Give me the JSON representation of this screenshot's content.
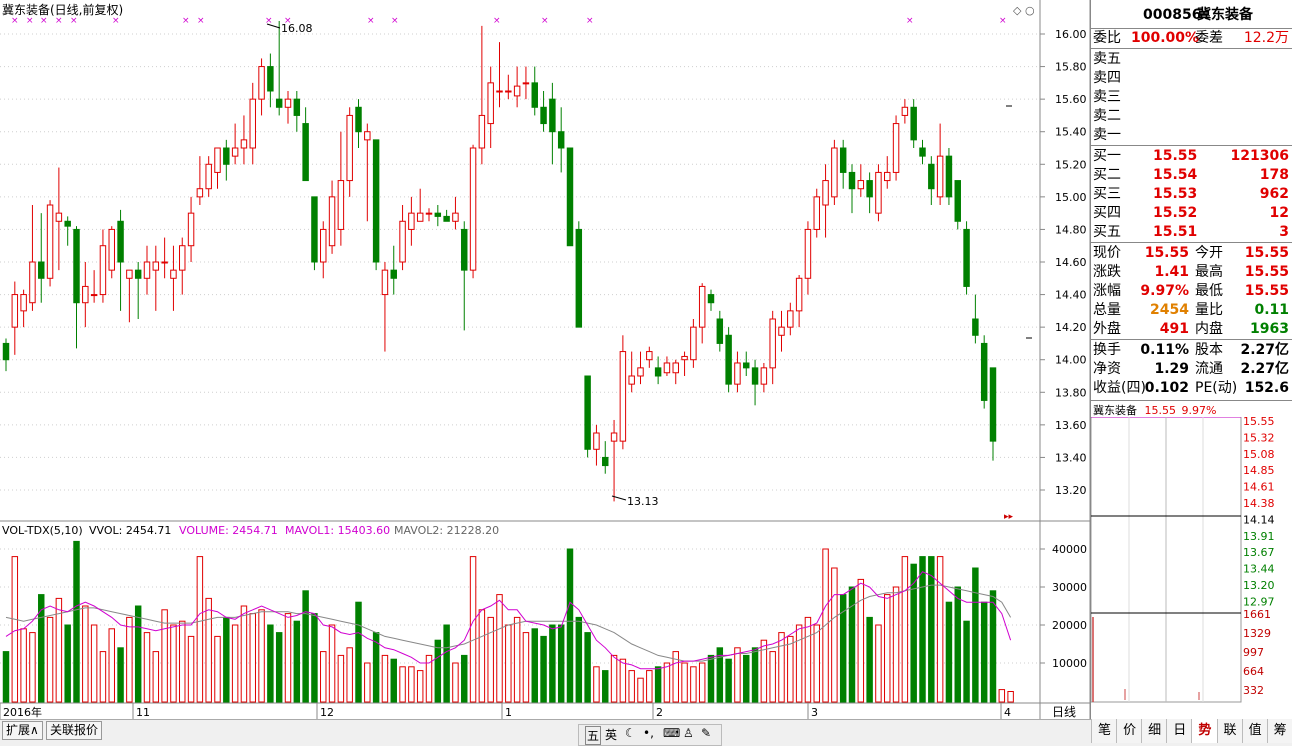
{
  "chart": {
    "title": "冀东装备(日线,前复权)",
    "max_label": "16.08",
    "min_label": "13.13",
    "price_ticks": [
      "16.00",
      "15.80",
      "15.60",
      "15.40",
      "15.20",
      "15.00",
      "14.80",
      "14.60",
      "14.40",
      "14.20",
      "14.00",
      "13.80",
      "13.60",
      "13.40",
      "13.20"
    ],
    "vol_ticks": [
      "40000",
      "30000",
      "20000",
      "10000"
    ],
    "date_labels": [
      "2016年",
      "11",
      "12",
      "1",
      "2",
      "3",
      "4"
    ],
    "period_label": "日线",
    "volume_header": {
      "name": "VOL-TDX(5,10)",
      "vvol": "VVOL: 2454.71",
      "volume": "VOLUME: 2454.71",
      "mavol1": "MAVOL1: 15403.60",
      "mavol2": "MAVOL2: 21228.20"
    },
    "colors": {
      "up": "#e00000",
      "down": "#008000",
      "ma1": "#d000d0",
      "ma2": "#888888"
    }
  },
  "chart_data": {
    "type": "candlestick",
    "title": "冀东装备(日线,前复权)",
    "ylim": [
      13.0,
      16.15
    ],
    "candles": [
      {
        "o": 14.1,
        "c": 14.0,
        "h": 14.13,
        "l": 13.93
      },
      {
        "o": 14.2,
        "c": 14.4,
        "h": 14.48,
        "l": 14.03
      },
      {
        "o": 14.3,
        "c": 14.4,
        "h": 14.43,
        "l": 14.2
      },
      {
        "o": 14.35,
        "c": 14.6,
        "h": 14.95,
        "l": 14.3
      },
      {
        "o": 14.6,
        "c": 14.5,
        "h": 14.9,
        "l": 14.35
      },
      {
        "o": 14.5,
        "c": 14.95,
        "h": 14.98,
        "l": 14.45
      },
      {
        "o": 14.85,
        "c": 14.9,
        "h": 15.18,
        "l": 14.55
      },
      {
        "o": 14.85,
        "c": 14.82,
        "h": 14.88,
        "l": 14.7
      },
      {
        "o": 14.8,
        "c": 14.35,
        "h": 14.82,
        "l": 14.07
      },
      {
        "o": 14.35,
        "c": 14.45,
        "h": 14.6,
        "l": 14.2
      },
      {
        "o": 14.4,
        "c": 14.4,
        "h": 14.55,
        "l": 14.35
      },
      {
        "o": 14.4,
        "c": 14.7,
        "h": 14.8,
        "l": 14.35
      },
      {
        "o": 14.55,
        "c": 14.8,
        "h": 14.82,
        "l": 14.5
      },
      {
        "o": 14.85,
        "c": 14.6,
        "h": 14.92,
        "l": 14.3
      },
      {
        "o": 14.5,
        "c": 14.55,
        "h": 14.55,
        "l": 14.23
      },
      {
        "o": 14.55,
        "c": 14.5,
        "h": 14.6,
        "l": 14.25
      },
      {
        "o": 14.5,
        "c": 14.6,
        "h": 14.7,
        "l": 14.4
      },
      {
        "o": 14.55,
        "c": 14.6,
        "h": 14.7,
        "l": 14.3
      },
      {
        "o": 14.6,
        "c": 14.6,
        "h": 14.75,
        "l": 14.5
      },
      {
        "o": 14.5,
        "c": 14.55,
        "h": 14.7,
        "l": 14.3
      },
      {
        "o": 14.55,
        "c": 14.7,
        "h": 14.75,
        "l": 14.4
      },
      {
        "o": 14.7,
        "c": 14.9,
        "h": 15.0,
        "l": 14.6
      },
      {
        "o": 15.0,
        "c": 15.05,
        "h": 15.25,
        "l": 14.95
      },
      {
        "o": 15.05,
        "c": 15.2,
        "h": 15.25,
        "l": 15.0
      },
      {
        "o": 15.15,
        "c": 15.3,
        "h": 15.3,
        "l": 15.05
      },
      {
        "o": 15.3,
        "c": 15.2,
        "h": 15.35,
        "l": 15.1
      },
      {
        "o": 15.25,
        "c": 15.3,
        "h": 15.45,
        "l": 15.2
      },
      {
        "o": 15.3,
        "c": 15.35,
        "h": 15.5,
        "l": 15.2
      },
      {
        "o": 15.3,
        "c": 15.6,
        "h": 15.7,
        "l": 15.2
      },
      {
        "o": 15.6,
        "c": 15.8,
        "h": 15.85,
        "l": 15.5
      },
      {
        "o": 15.8,
        "c": 15.65,
        "h": 15.88,
        "l": 15.55
      },
      {
        "o": 15.6,
        "c": 15.55,
        "h": 16.08,
        "l": 15.5
      },
      {
        "o": 15.55,
        "c": 15.6,
        "h": 15.65,
        "l": 15.45
      },
      {
        "o": 15.6,
        "c": 15.5,
        "h": 15.65,
        "l": 15.4
      },
      {
        "o": 15.45,
        "c": 15.1,
        "h": 15.55,
        "l": 15.1
      },
      {
        "o": 15.0,
        "c": 14.6,
        "h": 15.0,
        "l": 14.55
      },
      {
        "o": 14.6,
        "c": 14.8,
        "h": 14.85,
        "l": 14.5
      },
      {
        "o": 14.7,
        "c": 15.0,
        "h": 15.1,
        "l": 14.65
      },
      {
        "o": 14.8,
        "c": 15.1,
        "h": 15.4,
        "l": 14.7
      },
      {
        "o": 15.1,
        "c": 15.5,
        "h": 15.55,
        "l": 15.0
      },
      {
        "o": 15.55,
        "c": 15.4,
        "h": 15.6,
        "l": 15.3
      },
      {
        "o": 15.35,
        "c": 15.4,
        "h": 15.45,
        "l": 14.85
      },
      {
        "o": 15.35,
        "c": 14.6,
        "h": 15.35,
        "l": 14.55
      },
      {
        "o": 14.4,
        "c": 14.55,
        "h": 14.6,
        "l": 14.05
      },
      {
        "o": 14.55,
        "c": 14.5,
        "h": 14.7,
        "l": 14.4
      },
      {
        "o": 14.6,
        "c": 14.85,
        "h": 14.95,
        "l": 14.55
      },
      {
        "o": 14.8,
        "c": 14.9,
        "h": 15.0,
        "l": 14.7
      },
      {
        "o": 14.85,
        "c": 14.9,
        "h": 15.05,
        "l": 14.85
      },
      {
        "o": 14.9,
        "c": 14.9,
        "h": 14.93,
        "l": 14.85
      },
      {
        "o": 14.9,
        "c": 14.88,
        "h": 14.95,
        "l": 14.82
      },
      {
        "o": 14.88,
        "c": 14.85,
        "h": 14.92,
        "l": 14.85
      },
      {
        "o": 14.85,
        "c": 14.9,
        "h": 15.0,
        "l": 14.8
      },
      {
        "o": 14.8,
        "c": 14.55,
        "h": 14.85,
        "l": 14.18
      },
      {
        "o": 14.55,
        "c": 15.3,
        "h": 15.32,
        "l": 14.5
      },
      {
        "o": 15.3,
        "c": 15.5,
        "h": 16.05,
        "l": 15.2
      },
      {
        "o": 15.45,
        "c": 15.7,
        "h": 15.8,
        "l": 15.3
      },
      {
        "o": 15.65,
        "c": 15.65,
        "h": 15.95,
        "l": 15.55
      },
      {
        "o": 15.65,
        "c": 15.65,
        "h": 15.75,
        "l": 15.6
      },
      {
        "o": 15.62,
        "c": 15.68,
        "h": 15.8,
        "l": 15.55
      },
      {
        "o": 15.7,
        "c": 15.7,
        "h": 15.8,
        "l": 15.6
      },
      {
        "o": 15.7,
        "c": 15.55,
        "h": 15.8,
        "l": 15.5
      },
      {
        "o": 15.55,
        "c": 15.45,
        "h": 15.65,
        "l": 15.4
      },
      {
        "o": 15.6,
        "c": 15.4,
        "h": 15.7,
        "l": 15.2
      },
      {
        "o": 15.4,
        "c": 15.3,
        "h": 15.55,
        "l": 15.15
      },
      {
        "o": 15.3,
        "c": 14.7,
        "h": 15.3,
        "l": 14.7
      },
      {
        "o": 14.8,
        "c": 14.2,
        "h": 14.85,
        "l": 14.2
      },
      {
        "o": 13.9,
        "c": 13.45,
        "h": 13.9,
        "l": 13.4
      },
      {
        "o": 13.45,
        "c": 13.55,
        "h": 13.6,
        "l": 13.35
      },
      {
        "o": 13.4,
        "c": 13.35,
        "h": 13.5,
        "l": 13.3
      },
      {
        "o": 13.5,
        "c": 13.55,
        "h": 13.63,
        "l": 13.13
      },
      {
        "o": 13.5,
        "c": 14.05,
        "h": 14.15,
        "l": 13.45
      },
      {
        "o": 13.85,
        "c": 13.9,
        "h": 14.05,
        "l": 13.8
      },
      {
        "o": 13.9,
        "c": 13.95,
        "h": 14.05,
        "l": 13.85
      },
      {
        "o": 14.0,
        "c": 14.05,
        "h": 14.08,
        "l": 13.95
      },
      {
        "o": 13.95,
        "c": 13.9,
        "h": 14.02,
        "l": 13.85
      },
      {
        "o": 13.92,
        "c": 13.98,
        "h": 14.02,
        "l": 13.9
      },
      {
        "o": 13.92,
        "c": 13.98,
        "h": 14.0,
        "l": 13.85
      },
      {
        "o": 14.0,
        "c": 14.02,
        "h": 14.05,
        "l": 13.9
      },
      {
        "o": 14.0,
        "c": 14.2,
        "h": 14.25,
        "l": 13.95
      },
      {
        "o": 14.2,
        "c": 14.45,
        "h": 14.47,
        "l": 14.1
      },
      {
        "o": 14.4,
        "c": 14.35,
        "h": 14.43,
        "l": 14.3
      },
      {
        "o": 14.25,
        "c": 14.1,
        "h": 14.3,
        "l": 14.05
      },
      {
        "o": 14.15,
        "c": 13.85,
        "h": 14.2,
        "l": 13.8
      },
      {
        "o": 13.85,
        "c": 13.98,
        "h": 14.05,
        "l": 13.8
      },
      {
        "o": 13.98,
        "c": 13.95,
        "h": 14.05,
        "l": 13.9
      },
      {
        "o": 13.95,
        "c": 13.85,
        "h": 14.0,
        "l": 13.72
      },
      {
        "o": 13.85,
        "c": 13.95,
        "h": 13.98,
        "l": 13.8
      },
      {
        "o": 13.95,
        "c": 14.25,
        "h": 14.3,
        "l": 13.85
      },
      {
        "o": 14.15,
        "c": 14.2,
        "h": 14.3,
        "l": 14.05
      },
      {
        "o": 14.2,
        "c": 14.3,
        "h": 14.35,
        "l": 14.15
      },
      {
        "o": 14.3,
        "c": 14.5,
        "h": 14.52,
        "l": 14.2
      },
      {
        "o": 14.5,
        "c": 14.8,
        "h": 14.85,
        "l": 14.4
      },
      {
        "o": 14.8,
        "c": 15.0,
        "h": 15.05,
        "l": 14.75
      },
      {
        "o": 14.95,
        "c": 15.1,
        "h": 15.2,
        "l": 14.75
      },
      {
        "o": 15.0,
        "c": 15.3,
        "h": 15.35,
        "l": 14.95
      },
      {
        "o": 15.3,
        "c": 15.15,
        "h": 15.35,
        "l": 15.05
      },
      {
        "o": 15.15,
        "c": 15.05,
        "h": 15.2,
        "l": 14.9
      },
      {
        "o": 15.05,
        "c": 15.1,
        "h": 15.2,
        "l": 15.0
      },
      {
        "o": 15.1,
        "c": 15.0,
        "h": 15.15,
        "l": 14.9
      },
      {
        "o": 14.9,
        "c": 15.15,
        "h": 15.2,
        "l": 14.85
      },
      {
        "o": 15.1,
        "c": 15.15,
        "h": 15.25,
        "l": 15.05
      },
      {
        "o": 15.15,
        "c": 15.45,
        "h": 15.5,
        "l": 15.1
      },
      {
        "o": 15.5,
        "c": 15.55,
        "h": 15.6,
        "l": 15.45
      },
      {
        "o": 15.55,
        "c": 15.35,
        "h": 15.6,
        "l": 15.3
      },
      {
        "o": 15.3,
        "c": 15.25,
        "h": 15.35,
        "l": 15.2
      },
      {
        "o": 15.2,
        "c": 15.05,
        "h": 15.25,
        "l": 14.95
      },
      {
        "o": 15.0,
        "c": 15.25,
        "h": 15.45,
        "l": 14.95
      },
      {
        "o": 15.25,
        "c": 15.0,
        "h": 15.3,
        "l": 14.95
      },
      {
        "o": 15.1,
        "c": 14.85,
        "h": 15.1,
        "l": 14.8
      },
      {
        "o": 14.8,
        "c": 14.45,
        "h": 14.85,
        "l": 14.4
      },
      {
        "o": 14.25,
        "c": 14.15,
        "h": 14.4,
        "l": 14.1
      },
      {
        "o": 14.1,
        "c": 13.75,
        "h": 14.15,
        "l": 13.7
      },
      {
        "o": 13.95,
        "c": 13.5,
        "h": 13.95,
        "l": 13.38
      }
    ],
    "volume": {
      "ylim": [
        0,
        45000
      ],
      "values": [
        13000,
        38000,
        19000,
        18000,
        28000,
        22000,
        27000,
        20000,
        42000,
        25000,
        20000,
        13000,
        19000,
        14000,
        22000,
        25000,
        18000,
        13000,
        24000,
        20000,
        21000,
        17000,
        38000,
        27000,
        17000,
        22000,
        20000,
        25000,
        23000,
        24000,
        20000,
        18000,
        23000,
        21000,
        29000,
        23000,
        13000,
        20000,
        12000,
        14000,
        26000,
        10000,
        18000,
        12000,
        11000,
        9000,
        9000,
        8000,
        12000,
        16000,
        20000,
        10000,
        12000,
        38000,
        24000,
        22000,
        28000,
        20000,
        22000,
        18000,
        19000,
        17000,
        20000,
        20000,
        40000,
        22000,
        18000,
        9000,
        8000,
        12000,
        11000,
        8000,
        6000,
        8000,
        9000,
        10000,
        13000,
        10000,
        9000,
        10000,
        12000,
        14000,
        11000,
        14000,
        12000,
        14000,
        16000,
        13000,
        18000,
        17000,
        20000,
        22000,
        20000,
        40000,
        35000,
        28000,
        30000,
        32000,
        22000,
        20000,
        28000,
        30000,
        38000,
        36000,
        38000,
        38000,
        38000,
        26000,
        30000,
        21000,
        35000,
        26000,
        29000,
        3000,
        2500
      ],
      "mavol1": [
        17000,
        18500,
        19000,
        21000,
        24000,
        25000,
        24000,
        23500,
        25000,
        26000,
        25000,
        23500,
        22000,
        20000,
        19500,
        19500,
        19000,
        18500,
        19000,
        19500,
        20000,
        20000,
        23000,
        24000,
        23500,
        22000,
        21500,
        23000,
        24000,
        25000,
        24000,
        23000,
        22000,
        22500,
        23500,
        23000,
        20000,
        19500,
        18000,
        17500,
        18000,
        16500,
        15500,
        14000,
        13500,
        12500,
        11500,
        10000,
        10000,
        11500,
        13000,
        14000,
        16000,
        21000,
        24000,
        25000,
        26500,
        24000,
        24000,
        21000,
        20500,
        20000,
        19000,
        19500,
        26000,
        24000,
        20000,
        16000,
        14000,
        11500,
        10000,
        9500,
        8500,
        8500,
        8500,
        9000,
        10000,
        10500,
        10500,
        11000,
        11500,
        12000,
        12000,
        12500,
        13000,
        13500,
        14500,
        15000,
        16000,
        17500,
        19000,
        19500,
        20500,
        25000,
        28000,
        28000,
        29500,
        31000,
        30000,
        27500,
        27000,
        28000,
        29000,
        31000,
        34000,
        33000,
        31000,
        29000,
        27000,
        26000,
        26000,
        26000,
        26000,
        23000,
        16000
      ],
      "mavol2": [
        22000,
        21500,
        21000,
        21500,
        22000,
        22500,
        23000,
        23500,
        24000,
        24500,
        24500,
        24000,
        23500,
        23000,
        22500,
        22000,
        21500,
        21000,
        20500,
        20500,
        20500,
        20500,
        21000,
        21500,
        22000,
        22000,
        22000,
        22500,
        23000,
        23500,
        23500,
        23500,
        23500,
        23000,
        23000,
        22500,
        22000,
        21500,
        21000,
        20500,
        20000,
        19000,
        18000,
        17000,
        16500,
        16000,
        15500,
        15000,
        14500,
        14000,
        14000,
        14500,
        15000,
        16000,
        17000,
        18000,
        19000,
        20000,
        20500,
        21000,
        21000,
        21000,
        21000,
        21000,
        21000,
        21000,
        20500,
        20000,
        19000,
        18000,
        16500,
        15000,
        14000,
        13000,
        12000,
        11500,
        11000,
        10500,
        10500,
        10500,
        11000,
        11500,
        12000,
        12500,
        12500,
        13000,
        13500,
        14000,
        14500,
        15000,
        16000,
        17000,
        18000,
        20000,
        22000,
        23500,
        25000,
        26500,
        27500,
        28000,
        28500,
        28500,
        29000,
        29500,
        30000,
        30500,
        30500,
        30000,
        29500,
        29000,
        28500,
        28000,
        27500,
        26000,
        22000
      ]
    }
  },
  "right_panel": {
    "code": "000856",
    "name": "冀东装备",
    "weibi_label": "委比",
    "weibi_value": "100.00%",
    "weicha_label": "委差",
    "weicha_value": "12.2万",
    "sell_levels": [
      "卖五",
      "卖四",
      "卖三",
      "卖二",
      "卖一"
    ],
    "buy_levels": [
      {
        "label": "买一",
        "price": "15.55",
        "vol": "121306"
      },
      {
        "label": "买二",
        "price": "15.54",
        "vol": "178"
      },
      {
        "label": "买三",
        "price": "15.53",
        "vol": "962"
      },
      {
        "label": "买四",
        "price": "15.52",
        "vol": "12"
      },
      {
        "label": "买五",
        "price": "15.51",
        "vol": "3"
      }
    ],
    "quote_rows": [
      {
        "l1": "现价",
        "v1": "15.55",
        "l2": "今开",
        "v2": "15.55",
        "c1": "red",
        "c2": "red"
      },
      {
        "l1": "涨跌",
        "v1": "1.41",
        "l2": "最高",
        "v2": "15.55",
        "c1": "red",
        "c2": "red"
      },
      {
        "l1": "涨幅",
        "v1": "9.97%",
        "l2": "最低",
        "v2": "15.55",
        "c1": "red",
        "c2": "red"
      },
      {
        "l1": "总量",
        "v1": "2454",
        "l2": "量比",
        "v2": "0.11",
        "c1": "orange",
        "c2": "green"
      },
      {
        "l1": "外盘",
        "v1": "491",
        "l2": "内盘",
        "v2": "1963",
        "c1": "red",
        "c2": "green"
      }
    ],
    "fin_rows": [
      {
        "l1": "换手",
        "v1": "0.11%",
        "l2": "股本",
        "v2": "2.27亿"
      },
      {
        "l1": "净资",
        "v1": "1.29",
        "l2": "流通",
        "v2": "2.27亿"
      },
      {
        "l1": "收益(四)",
        "v1": "0.102",
        "l2": "PE(动)",
        "v2": "152.6"
      }
    ],
    "mini_title": "冀东装备",
    "mini_price": "15.55",
    "mini_pct": "9.97%",
    "mini_price_ticks": [
      "15.55",
      "15.32",
      "15.08",
      "14.85",
      "14.61",
      "14.38",
      "14.14",
      "13.91",
      "13.67",
      "13.44",
      "13.20",
      "12.97"
    ],
    "mini_vol_ticks": [
      "1661",
      "1329",
      "997",
      "664",
      "332"
    ],
    "tabs": [
      "笔",
      "价",
      "细",
      "日",
      "势",
      "联",
      "值",
      "筹"
    ]
  },
  "bottom_tabs": [
    "扩展∧",
    "关联报价"
  ],
  "ime_items": [
    "五",
    "英"
  ]
}
